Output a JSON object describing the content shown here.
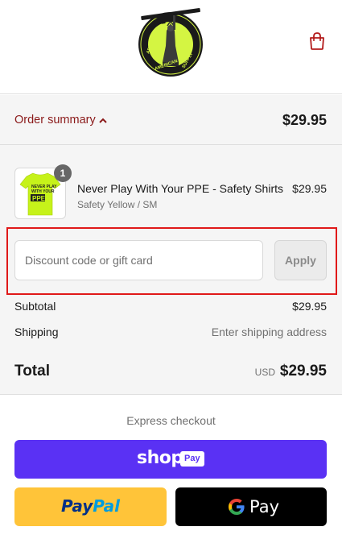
{
  "header": {
    "logo_text": "ARMED AMERICAN SUPPLY",
    "cart_icon": "shopping-bag-icon"
  },
  "order_summary": {
    "toggle_label": "Order summary",
    "toggle_icon": "chevron-up-icon",
    "total": "$29.95"
  },
  "line_item": {
    "quantity": "1",
    "title": "Never Play With Your PPE - Safety Shirts",
    "variant": "Safety Yellow / SM",
    "price": "$29.95",
    "shirt_text": "NEVER PLAY WITH YOUR PPE"
  },
  "discount": {
    "placeholder": "Discount code or gift card",
    "apply_label": "Apply"
  },
  "costs": {
    "subtotal_label": "Subtotal",
    "subtotal_value": "$29.95",
    "shipping_label": "Shipping",
    "shipping_value": "Enter shipping address",
    "total_label": "Total",
    "currency": "USD",
    "total_value": "$29.95"
  },
  "express": {
    "label": "Express checkout",
    "shop_logo": "shop",
    "shop_pay": "Pay",
    "paypal_part1": "Pay",
    "paypal_part2": "Pal",
    "gpay_text": "Pay"
  },
  "colors": {
    "accent_red": "#8b1a1a",
    "highlight_box": "#e01919",
    "shop_pay_purple": "#5a31f4",
    "paypal_yellow": "#ffc439",
    "gpay_black": "#000000",
    "logo_lime": "#d4f542"
  }
}
